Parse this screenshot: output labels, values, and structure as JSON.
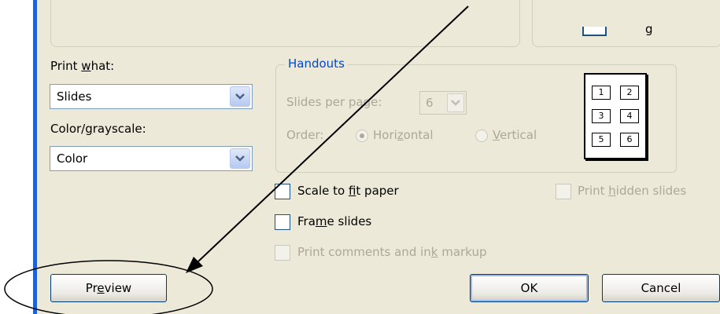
{
  "print_what": {
    "label_pre": "Print ",
    "label_key": "w",
    "label_post": "hat:",
    "value": "Slides"
  },
  "color_grayscale": {
    "label_pre": "Color/",
    "label_key": "g",
    "label_post": "rayscale:",
    "value": "Color"
  },
  "handouts": {
    "title": "Handouts",
    "slides_per_page_label": "Slides per page:",
    "slides_per_page_value": "6",
    "order_label": "Order:",
    "horizontal_pre": "Hori",
    "horizontal_key": "z",
    "horizontal_post": "ontal",
    "vertical_key": "V",
    "vertical_post": "ertical",
    "layout_numbers": [
      "1",
      "2",
      "3",
      "4",
      "5",
      "6"
    ]
  },
  "options": {
    "scale_pre": "Scale to ",
    "scale_key": "f",
    "scale_post": "it paper",
    "frame_pre": "Fra",
    "frame_key": "m",
    "frame_post": "e slides",
    "comments_pre": "Print comments and in",
    "comments_key": "k",
    "comments_post": " markup",
    "hidden_pre": "Print ",
    "hidden_key": "h",
    "hidden_post": "idden slides"
  },
  "buttons": {
    "preview_pre": "Pr",
    "preview_key": "e",
    "preview_post": "view",
    "ok": "OK",
    "cancel": "Cancel"
  },
  "colors": {
    "dialog_bg": "#ece9d8",
    "accent_border": "#1e63d6",
    "title_blue": "#0046d5",
    "disabled_text": "#aca899"
  }
}
